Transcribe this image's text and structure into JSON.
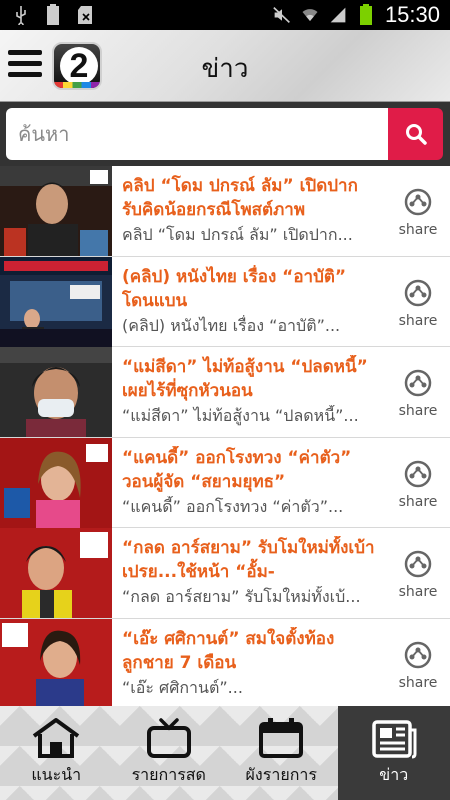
{
  "status_bar": {
    "time": "15:30",
    "left_icons": [
      "usb-icon",
      "battery-full-icon",
      "sd-card-error-icon"
    ],
    "right_icons": [
      "mute-icon",
      "wifi-icon",
      "signal-icon",
      "battery-charging-icon"
    ]
  },
  "header": {
    "title": "ข่าว",
    "logo_text": "2"
  },
  "search": {
    "placeholder": "ค้นหา"
  },
  "news": [
    {
      "title": "คลิป “โดม ปกรณ์ ลัม” เปิดปากรับคิดน้อยกรณีโพสต์ภาพ",
      "subtitle": "คลิป “โดม ปกรณ์ ลัม” เปิดปาก...",
      "share_label": "share"
    },
    {
      "title": "(คลิป) หนังไทย เรื่อง “อาบัติ” โดนแบน",
      "subtitle": "(คลิป) หนังไทย เรื่อง “อาบัติ”...",
      "share_label": "share"
    },
    {
      "title": "“แม่สีดา” ไม่ท้อสู้งาน “ปลดหนี้” เผยไร้ที่ซุกหัวนอน",
      "subtitle": "“แม่สีดา” ไม่ท้อสู้งาน “ปลดหนี้”...",
      "share_label": "share"
    },
    {
      "title": "“แคนดี้” ออกโรงทวง “ค่าตัว” วอนผู้จัด “สยามยุทธ”",
      "subtitle": "“แคนดี้” ออกโรงทวง “ค่าตัว”...",
      "share_label": "share"
    },
    {
      "title": "“กลด อาร์สยาม” รับโมใหม่ทั้งเบ้าเปรย...ใช้หน้า “อั้ม-",
      "subtitle": "“กลด อาร์สยาม” รับโมใหม่ทั้งเบ้...",
      "share_label": "share"
    },
    {
      "title": "“เอ๊ะ ศศิกานต์” สมใจตั้งท้องลูกชาย 7 เดือน",
      "subtitle": "“เอ๊ะ ศศิกานต์”...",
      "share_label": "share"
    }
  ],
  "bottom_nav": [
    {
      "label": "แนะนำ",
      "icon": "home-icon",
      "active": false
    },
    {
      "label": "รายการสด",
      "icon": "tv-icon",
      "active": false
    },
    {
      "label": "ผังรายการ",
      "icon": "calendar-icon",
      "active": false
    },
    {
      "label": "ข่าว",
      "icon": "newspaper-icon",
      "active": true
    }
  ],
  "colors": {
    "accent_orange": "#e8601c",
    "search_button": "#e01c48",
    "active_nav": "#3a3a3a"
  }
}
